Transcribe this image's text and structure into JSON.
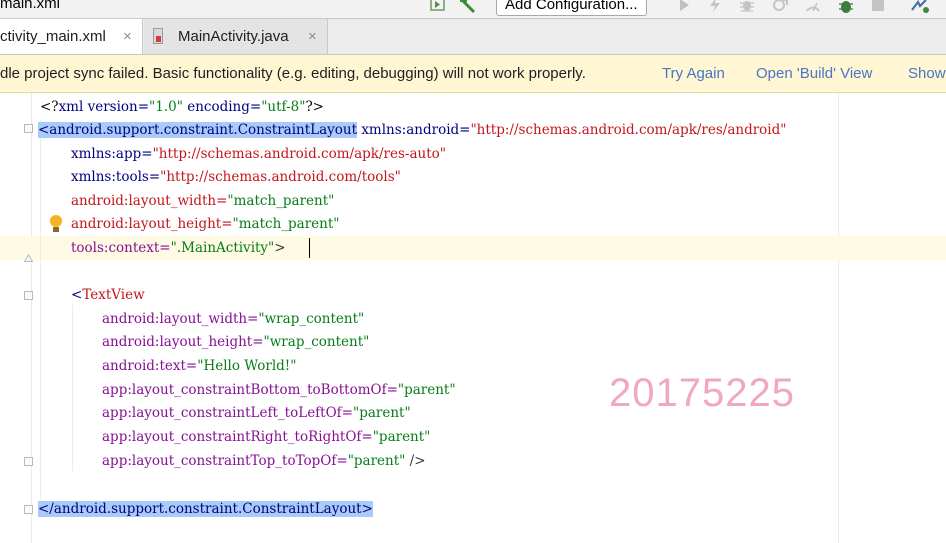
{
  "toolbar": {
    "file_crumb": "main.xml",
    "config_label": "Add Configuration..."
  },
  "tabs": [
    {
      "label": "ctivity_main.xml",
      "close": "×"
    },
    {
      "label": "MainActivity.java",
      "close": "×"
    }
  ],
  "notification": {
    "message": "dle project sync failed. Basic functionality (e.g. editing, debugging) will not work properly.",
    "try_again": "Try Again",
    "open_build": "Open 'Build' View",
    "show": "Show"
  },
  "code": {
    "l1": {
      "a": "<?",
      "b": "xml version=",
      "c": "\"1.0\"",
      "d": " encoding=",
      "e": "\"utf-8\"",
      "f": "?>"
    },
    "l2": {
      "tag": "<android.support.constraint.ConstraintLayout",
      "attr": " xmlns:android=",
      "val": "\"http://schemas.android.com/apk/res/android\""
    },
    "l3": {
      "attr": "xmlns:app=",
      "val": "\"http://schemas.android.com/apk/res-auto\""
    },
    "l4": {
      "attr": "xmlns:tools=",
      "val": "\"http://schemas.android.com/tools\""
    },
    "l5": {
      "attr": "android:layout_width=",
      "val": "\"match_parent\""
    },
    "l6": {
      "attr": "android:layout_height=",
      "val": "\"match_parent\""
    },
    "l7": {
      "attr": "tools:context=",
      "val": "\".MainActivity\"",
      "end": ">"
    },
    "l9": {
      "lt": "<",
      "tag": "TextView"
    },
    "l10": {
      "attr": "android:layout_width=",
      "val": "\"wrap_content\""
    },
    "l11": {
      "attr": "android:layout_height=",
      "val": "\"wrap_content\""
    },
    "l12": {
      "attr": "android:text=",
      "val": "\"Hello World!\""
    },
    "l13": {
      "attr": "app:layout_constraintBottom_toBottomOf=",
      "val": "\"parent\""
    },
    "l14": {
      "attr": "app:layout_constraintLeft_toLeftOf=",
      "val": "\"parent\""
    },
    "l15": {
      "attr": "app:layout_constraintRight_toRightOf=",
      "val": "\"parent\""
    },
    "l16": {
      "attr": "app:layout_constraintTop_toTopOf=",
      "val": "\"parent\"",
      "end": " />"
    },
    "l18": {
      "tag": "</android.support.constraint.ConstraintLayout>"
    }
  },
  "watermark": "20175225",
  "colors": {
    "tag": "#000080",
    "attribute": "#871094",
    "value": "#067d17",
    "selection": "#a8cbf8",
    "warning_bg": "#fff7d4",
    "link": "#4a75c2",
    "watermark": "#f2a7c0"
  },
  "icons": [
    "run-target-icon",
    "hammer-icon",
    "run-icon",
    "debug-icon",
    "bug-icon",
    "apply-changes-icon",
    "profiler-icon",
    "attach-debugger-icon",
    "stop-icon",
    "sync-icon",
    "bulb-icon",
    "fold-icon"
  ]
}
